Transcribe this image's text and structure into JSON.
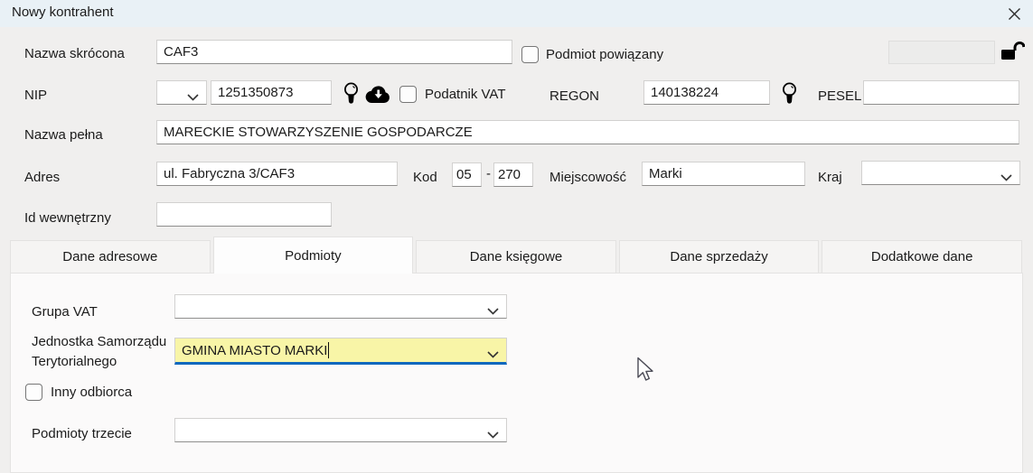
{
  "window": {
    "title": "Nowy kontrahent"
  },
  "colors": {
    "accent": "#1168bd",
    "highlight": "#f8f5a7",
    "titlebar": "#e9f1f6",
    "bodybg": "#f0efee"
  },
  "fields": {
    "nazwa_skrocona": {
      "label": "Nazwa skrócona",
      "value": "CAF3"
    },
    "podmiot_powiazany": {
      "label": "Podmiot powiązany",
      "checked": false
    },
    "locked_field": {
      "value": "",
      "lock_icon": "open-padlock"
    },
    "nip": {
      "label": "NIP",
      "prefix_value": "",
      "value": "1251350873",
      "icons": [
        "lightbulb-icon",
        "cloud-download-icon"
      ]
    },
    "podatnik_vat": {
      "label": "Podatnik VAT",
      "checked": false
    },
    "regon": {
      "label": "REGON",
      "value": "140138224",
      "icons": [
        "lightbulb-icon"
      ]
    },
    "pesel": {
      "label": "PESEL",
      "value": ""
    },
    "nazwa_pelna": {
      "label": "Nazwa pełna",
      "value": "MARECKIE STOWARZYSZENIE GOSPODARCZE"
    },
    "adres": {
      "label": "Adres",
      "value": "ul. Fabryczna 3/CAF3"
    },
    "kod": {
      "label": "Kod",
      "value1": "05",
      "separator": "-",
      "value2": "270"
    },
    "miejscowosc": {
      "label": "Miejscowość",
      "value": "Marki"
    },
    "kraj": {
      "label": "Kraj",
      "value": ""
    },
    "id_wewnetrzny": {
      "label": "Id wewnętrzny",
      "value": ""
    }
  },
  "tabs": [
    {
      "label": "Dane adresowe",
      "active": false
    },
    {
      "label": "Podmioty",
      "active": true
    },
    {
      "label": "Dane księgowe",
      "active": false
    },
    {
      "label": "Dane sprzedaży",
      "active": false
    },
    {
      "label": "Dodatkowe dane",
      "active": false
    }
  ],
  "podmioty_tab": {
    "grupa_vat": {
      "label": "Grupa VAT",
      "value": ""
    },
    "jednostka_samorzadu": {
      "label": "Jednostka Samorządu Terytorialnego",
      "value": "GMINA MIASTO MARKI",
      "focused": true
    },
    "inny_odbiorca": {
      "label": "Inny odbiorca",
      "checked": false
    },
    "podmioty_trzecie": {
      "label": "Podmioty trzecie",
      "value": ""
    }
  }
}
